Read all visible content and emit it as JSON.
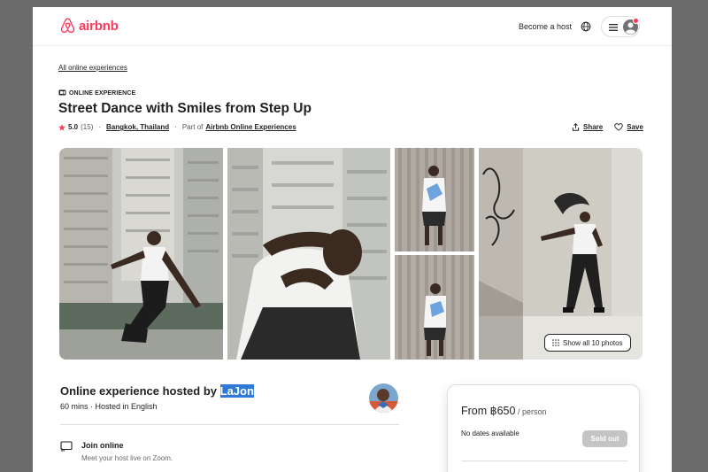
{
  "header": {
    "brand": "airbnb",
    "become_host": "Become a host",
    "brand_color": "#ff385c"
  },
  "breadcrumb": "All online experiences",
  "badge": "ONLINE EXPERIENCE",
  "title": "Street Dance with Smiles from Step Up",
  "meta": {
    "rating": "5.0",
    "reviews": "(15)",
    "dot": "·",
    "location": "Bangkok, Thailand",
    "part_of": "Part of",
    "collection": "Airbnb Online Experiences"
  },
  "actions": {
    "share": "Share",
    "save": "Save"
  },
  "gallery": {
    "show_all": "Show all 10 photos"
  },
  "host": {
    "title_prefix": "Online experience hosted by ",
    "name": "LaJon",
    "subtitle": "60 mins · Hosted in English"
  },
  "join": {
    "title": "Join online",
    "subtitle": "Meet your host live on Zoom."
  },
  "booking": {
    "price": "From ฿650",
    "per": " / person",
    "no_dates": "No dates available",
    "sold_out": "Sold out"
  }
}
